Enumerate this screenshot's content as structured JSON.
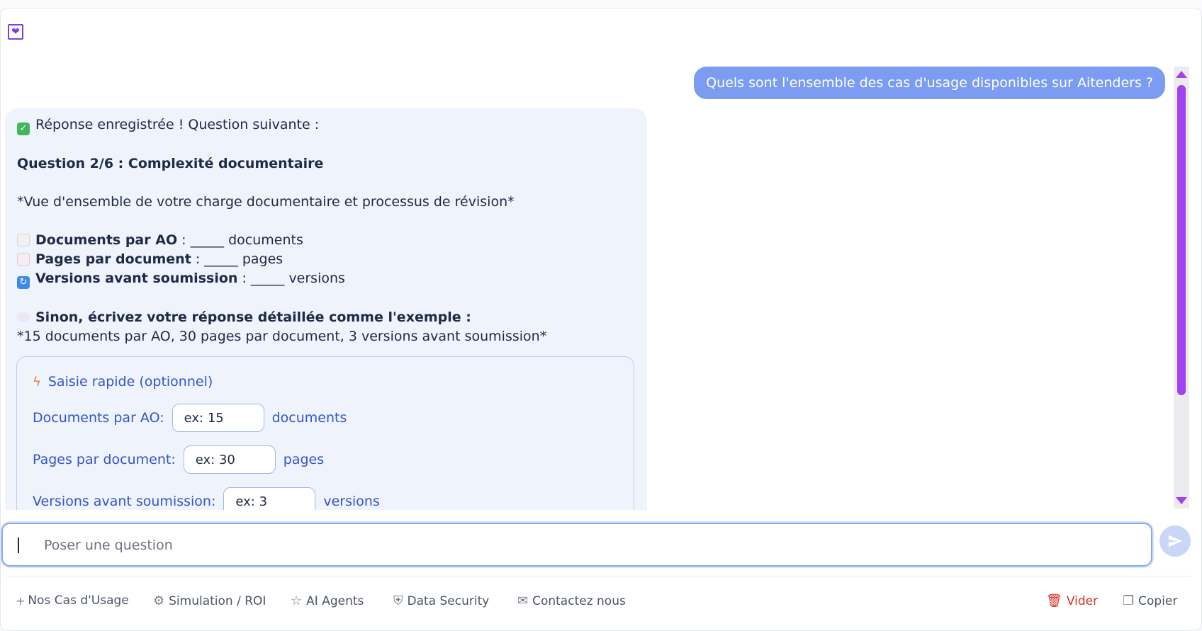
{
  "user_message": "Quels sont l'ensemble des cas d'usage disponibles sur Aitenders ?",
  "bot": {
    "line_saved": "Réponse enregistrée ! Question suivante :",
    "question_title": "Question 2/6 : Complexité documentaire",
    "subtitle": "*Vue d'ensemble de votre charge documentaire et processus de révision*",
    "fields": [
      {
        "label": "Documents par AO",
        "rest": " : _____ documents"
      },
      {
        "label": "Pages par document",
        "rest": " : _____ pages"
      },
      {
        "label": "Versions avant soumission",
        "rest": " : _____ versions"
      }
    ],
    "otherwise": "Sinon, écrivez votre réponse détaillée comme l'exemple :",
    "example": "*15 documents par AO, 30 pages par document, 3 versions avant soumission*"
  },
  "quick": {
    "title": "Saisie rapide (optionnel)",
    "rows": [
      {
        "label": "Documents par AO:",
        "placeholder": "ex: 15",
        "unit": "documents"
      },
      {
        "label": "Pages par document:",
        "placeholder": "ex: 30",
        "unit": "pages"
      },
      {
        "label": "Versions avant soumission:",
        "placeholder": "ex: 3",
        "unit": "versions"
      }
    ]
  },
  "composer": {
    "placeholder": "Poser une question"
  },
  "footer": {
    "use_cases": "Nos Cas d'Usage",
    "simulation": "Simulation / ROI",
    "agents": "AI Agents",
    "security": "Data Security",
    "contact": "Contactez nous",
    "clear": "Vider",
    "copy": "Copier"
  },
  "icons": {
    "logo": "chevron-box-icon",
    "send": "send-icon",
    "bolt": "bolt-icon"
  },
  "colors": {
    "accent": "#7b9cf0",
    "brand_purple": "#a042ee",
    "danger": "#d92d20"
  }
}
